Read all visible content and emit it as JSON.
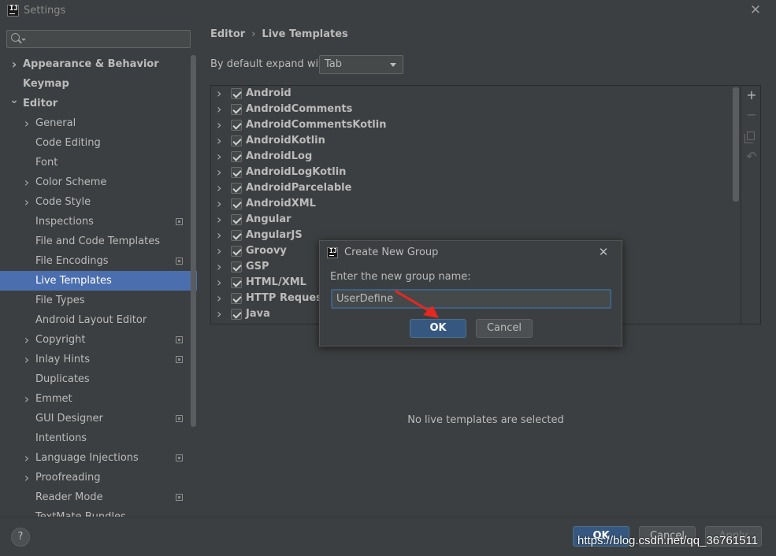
{
  "window": {
    "title": "Settings",
    "logo_text": "IJ"
  },
  "sidebar": {
    "search_placeholder": "",
    "items": [
      {
        "label": "Appearance & Behavior",
        "bold": true,
        "level": 0,
        "arrow": "right"
      },
      {
        "label": "Keymap",
        "bold": true,
        "level": 0,
        "arrow": ""
      },
      {
        "label": "Editor",
        "bold": true,
        "level": 0,
        "arrow": "down"
      },
      {
        "label": "General",
        "level": 1,
        "arrow": "right"
      },
      {
        "label": "Code Editing",
        "level": 1,
        "arrow": ""
      },
      {
        "label": "Font",
        "level": 1,
        "arrow": ""
      },
      {
        "label": "Color Scheme",
        "level": 1,
        "arrow": "right"
      },
      {
        "label": "Code Style",
        "level": 1,
        "arrow": "right"
      },
      {
        "label": "Inspections",
        "level": 1,
        "arrow": "",
        "project_icon": true
      },
      {
        "label": "File and Code Templates",
        "level": 1,
        "arrow": ""
      },
      {
        "label": "File Encodings",
        "level": 1,
        "arrow": "",
        "project_icon": true
      },
      {
        "label": "Live Templates",
        "level": 1,
        "arrow": "",
        "selected": true
      },
      {
        "label": "File Types",
        "level": 1,
        "arrow": ""
      },
      {
        "label": "Android Layout Editor",
        "level": 1,
        "arrow": ""
      },
      {
        "label": "Copyright",
        "level": 1,
        "arrow": "right",
        "project_icon": true
      },
      {
        "label": "Inlay Hints",
        "level": 1,
        "arrow": "right",
        "project_icon": true
      },
      {
        "label": "Duplicates",
        "level": 1,
        "arrow": ""
      },
      {
        "label": "Emmet",
        "level": 1,
        "arrow": "right"
      },
      {
        "label": "GUI Designer",
        "level": 1,
        "arrow": "",
        "project_icon": true
      },
      {
        "label": "Intentions",
        "level": 1,
        "arrow": ""
      },
      {
        "label": "Language Injections",
        "level": 1,
        "arrow": "right",
        "project_icon": true
      },
      {
        "label": "Proofreading",
        "level": 1,
        "arrow": "right"
      },
      {
        "label": "Reader Mode",
        "level": 1,
        "arrow": "",
        "project_icon": true
      },
      {
        "label": "TextMate Bundles",
        "level": 1,
        "arrow": ""
      }
    ]
  },
  "breadcrumb": {
    "parent": "Editor",
    "separator": "›",
    "current": "Live Templates"
  },
  "expand": {
    "label": "By default expand with",
    "value": "Tab"
  },
  "templates": {
    "groups": [
      {
        "name": "Android",
        "checked": true
      },
      {
        "name": "AndroidComments",
        "checked": true
      },
      {
        "name": "AndroidCommentsKotlin",
        "checked": true
      },
      {
        "name": "AndroidKotlin",
        "checked": true
      },
      {
        "name": "AndroidLog",
        "checked": true
      },
      {
        "name": "AndroidLogKotlin",
        "checked": true
      },
      {
        "name": "AndroidParcelable",
        "checked": true
      },
      {
        "name": "AndroidXML",
        "checked": true
      },
      {
        "name": "Angular",
        "checked": true
      },
      {
        "name": "AngularJS",
        "checked": true
      },
      {
        "name": "Groovy",
        "checked": true
      },
      {
        "name": "GSP",
        "checked": true
      },
      {
        "name": "HTML/XML",
        "checked": true
      },
      {
        "name": "HTTP Request",
        "checked": true
      },
      {
        "name": "Java",
        "checked": true
      }
    ],
    "tools": {
      "add": "+",
      "remove": "−",
      "restore": "↶"
    },
    "empty_message": "No live templates are selected"
  },
  "dialog": {
    "title": "Create New Group",
    "logo_text": "IJ",
    "close": "✕",
    "prompt": "Enter the new group name:",
    "input_value": "UserDefine",
    "ok_label": "OK",
    "cancel_label": "Cancel"
  },
  "footer": {
    "help": "?",
    "ok_label": "OK",
    "cancel_label": "Cancel",
    "apply_label": "Apply"
  },
  "watermark": "https://blog.csdn.net/qq_36761511",
  "colors": {
    "background": "#3c3f41",
    "selection": "#4b6eaf",
    "primary_button": "#365880",
    "annotation_arrow": "#e8271e"
  }
}
